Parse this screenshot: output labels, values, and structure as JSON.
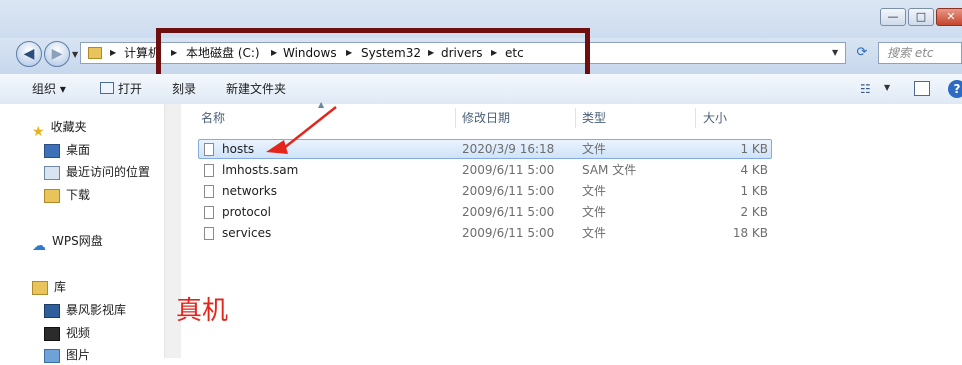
{
  "window": {
    "min_label": "—",
    "max_label": "□",
    "close_label": "✕"
  },
  "nav": {
    "back_icon": "◀",
    "forward_icon": "▶"
  },
  "breadcrumbs": [
    "计算机",
    "本地磁盘 (C:)",
    "Windows",
    "System32",
    "drivers",
    "etc"
  ],
  "search": {
    "placeholder": "搜索 etc"
  },
  "toolbar": {
    "organize": "组织 ▾",
    "open": "打开",
    "burn": "刻录",
    "new_folder": "新建文件夹"
  },
  "sidebar": {
    "favorites": "收藏夹",
    "desktop": "桌面",
    "recent": "最近访问的位置",
    "downloads": "下载",
    "wps": "WPS网盘",
    "library": "库",
    "storm": "暴风影视库",
    "video": "视频",
    "pictures": "图片"
  },
  "columns": {
    "name": "名称",
    "modified": "修改日期",
    "type": "类型",
    "size": "大小"
  },
  "files": [
    {
      "name": "hosts",
      "modified": "2020/3/9 16:18",
      "type": "文件",
      "size": "1 KB",
      "selected": true
    },
    {
      "name": "lmhosts.sam",
      "modified": "2009/6/11 5:00",
      "type": "SAM 文件",
      "size": "4 KB"
    },
    {
      "name": "networks",
      "modified": "2009/6/11 5:00",
      "type": "文件",
      "size": "1 KB"
    },
    {
      "name": "protocol",
      "modified": "2009/6/11 5:00",
      "type": "文件",
      "size": "2 KB"
    },
    {
      "name": "services",
      "modified": "2009/6/11 5:00",
      "type": "文件",
      "size": "18 KB"
    }
  ],
  "annotation": {
    "text": "真机",
    "color": "#e2261c",
    "box_color": "#6e0e0e"
  }
}
